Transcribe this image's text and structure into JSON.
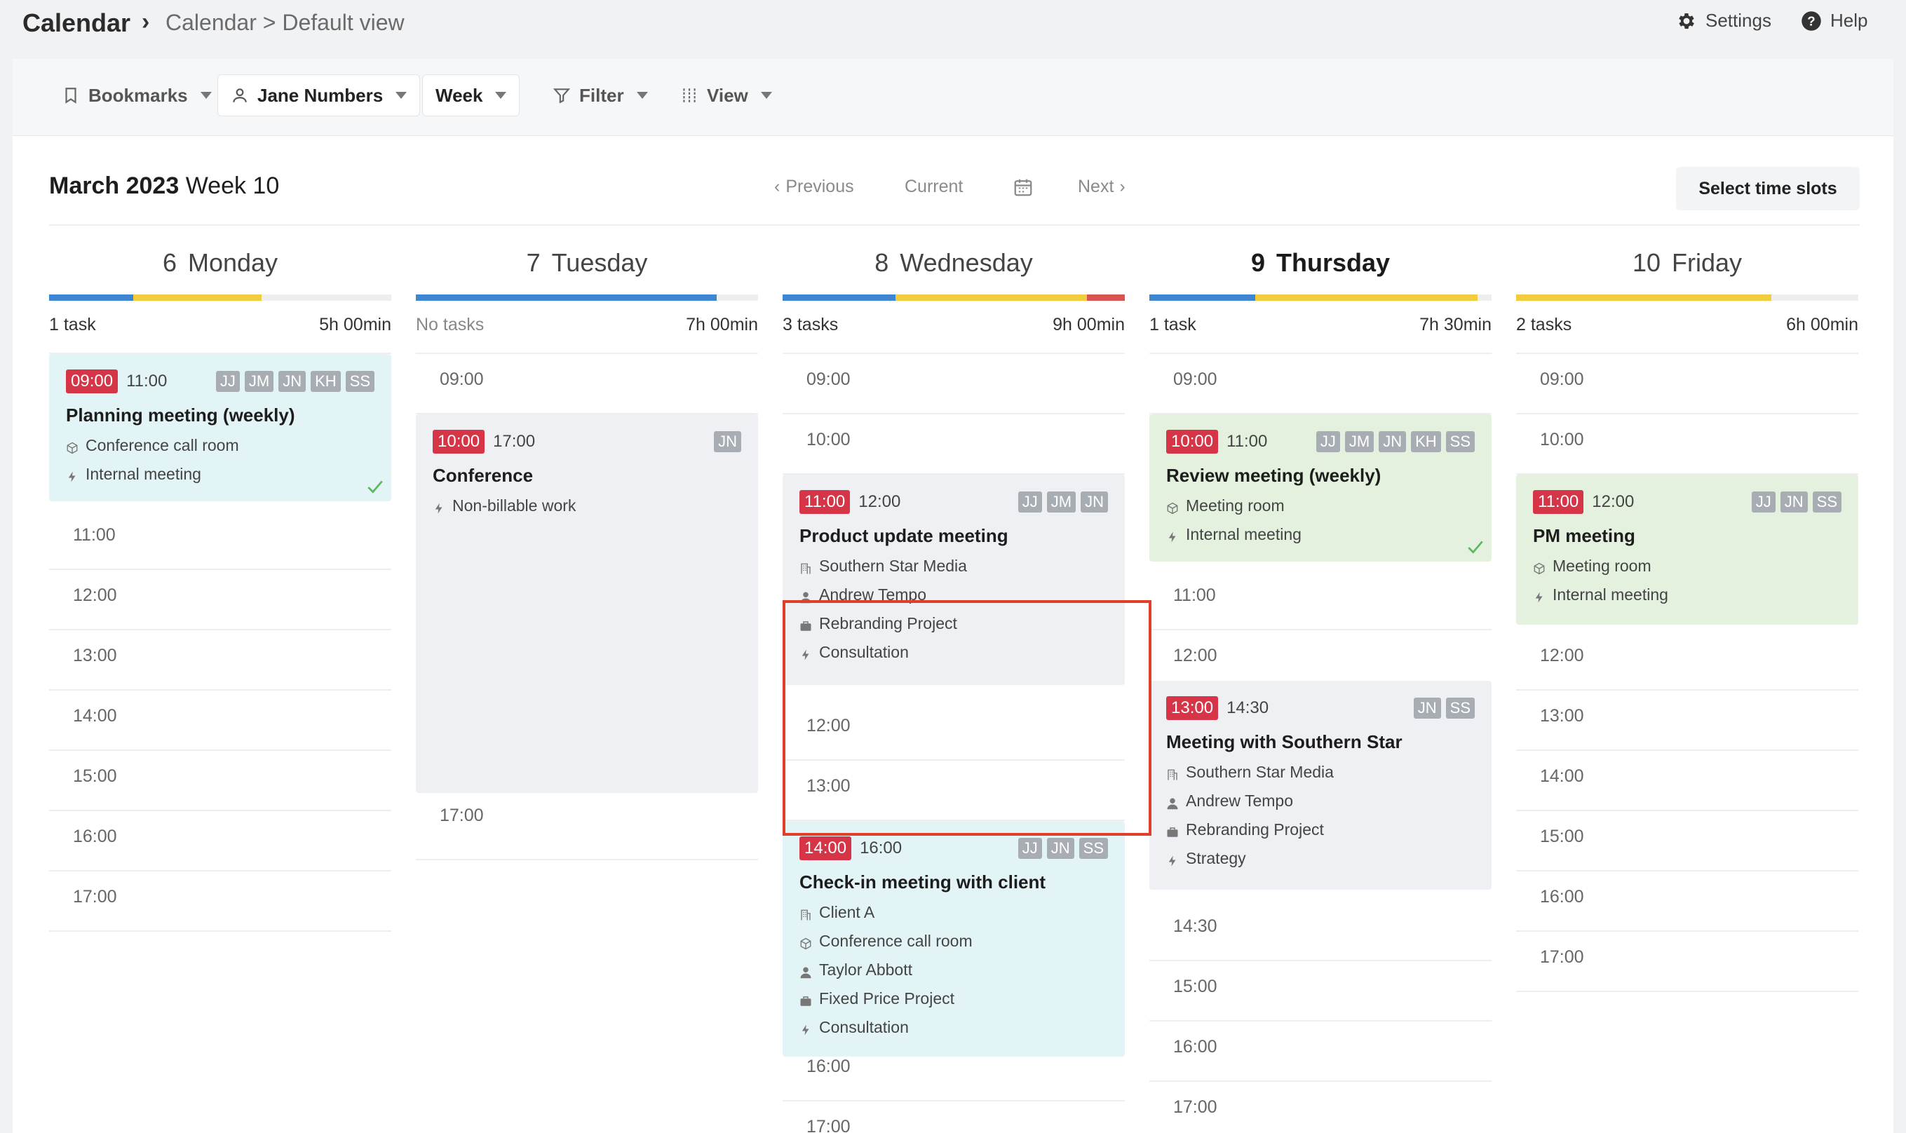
{
  "header": {
    "app_title": "Calendar",
    "breadcrumb_sep": "›",
    "breadcrumb": "Calendar > Default view",
    "settings": "Settings",
    "help": "Help"
  },
  "toolbar": {
    "bookmarks": "Bookmarks",
    "user": "Jane Numbers",
    "range": "Week",
    "filter": "Filter",
    "view": "View"
  },
  "main": {
    "month": "March 2023",
    "week": "Week 10",
    "previous": "Previous",
    "current": "Current",
    "next": "Next",
    "select_slots": "Select time slots"
  },
  "colors": {
    "blue": "#3f86d2",
    "yellow": "#f1cc3f",
    "red": "#d9534f",
    "badge": "#d63547"
  },
  "days": [
    {
      "num": "6",
      "name": "Monday",
      "tasks": "1 task",
      "hours": "5h 00min",
      "bar": [
        {
          "color": "#3f86d2",
          "pct": 24.5
        },
        {
          "color": "#f1cc3f",
          "pct": 37.5
        }
      ],
      "slots": [
        "11:00",
        "12:00",
        "13:00",
        "14:00",
        "15:00",
        "16:00",
        "17:00"
      ],
      "events": [
        {
          "start": "09:00",
          "end": "11:00",
          "initials": [
            "JJ",
            "JM",
            "JN",
            "KH",
            "SS"
          ],
          "title": "Planning meeting (weekly)",
          "lines": [
            {
              "icon": "cube",
              "text": "Conference call room"
            },
            {
              "icon": "bolt",
              "text": "Internal meeting"
            }
          ]
        }
      ]
    },
    {
      "num": "7",
      "name": "Tuesday",
      "tasks": "No tasks",
      "hours": "7h 00min",
      "bar": [
        {
          "color": "#3f86d2",
          "pct": 88
        }
      ],
      "slots": [
        "09:00",
        "17:00"
      ],
      "events": [
        {
          "start": "10:00",
          "end": "17:00",
          "initials": [
            "JN"
          ],
          "title": "Conference",
          "lines": [
            {
              "icon": "bolt",
              "text": "Non-billable work"
            }
          ]
        }
      ]
    },
    {
      "num": "8",
      "name": "Wednesday",
      "tasks": "3 tasks",
      "hours": "9h 00min",
      "bar": [
        {
          "color": "#3f86d2",
          "pct": 33
        },
        {
          "color": "#f1cc3f",
          "pct": 56
        },
        {
          "color": "#d9534f",
          "pct": 11
        }
      ],
      "slots": [
        "09:00",
        "10:00",
        "12:00",
        "13:00",
        "16:00",
        "17:00"
      ],
      "events": [
        {
          "start": "11:00",
          "end": "12:00",
          "initials": [
            "JJ",
            "JM",
            "JN"
          ],
          "title": "Product update meeting",
          "lines": [
            {
              "icon": "building",
              "text": "Southern Star Media"
            },
            {
              "icon": "person",
              "text": "Andrew Tempo"
            },
            {
              "icon": "case",
              "text": "Rebranding Project"
            },
            {
              "icon": "bolt",
              "text": "Consultation"
            }
          ]
        },
        {
          "start": "14:00",
          "end": "16:00",
          "initials": [
            "JJ",
            "JN",
            "SS"
          ],
          "title": "Check-in meeting with client",
          "lines": [
            {
              "icon": "building",
              "text": "Client A"
            },
            {
              "icon": "cube",
              "text": "Conference call room"
            },
            {
              "icon": "person",
              "text": "Taylor Abbott"
            },
            {
              "icon": "case",
              "text": "Fixed Price Project"
            },
            {
              "icon": "bolt",
              "text": "Consultation"
            }
          ]
        }
      ]
    },
    {
      "num": "9",
      "name": "Thursday",
      "tasks": "1 task",
      "hours": "7h 30min",
      "bar": [
        {
          "color": "#3f86d2",
          "pct": 31
        },
        {
          "color": "#f1cc3f",
          "pct": 65
        }
      ],
      "slots": [
        "09:00",
        "11:00",
        "12:00",
        "14:30",
        "15:00",
        "16:00",
        "17:00"
      ],
      "events": [
        {
          "start": "10:00",
          "end": "11:00",
          "initials": [
            "JJ",
            "JM",
            "JN",
            "KH",
            "SS"
          ],
          "title": "Review meeting (weekly)",
          "lines": [
            {
              "icon": "cube",
              "text": "Meeting room"
            },
            {
              "icon": "bolt",
              "text": "Internal meeting"
            }
          ]
        },
        {
          "start": "13:00",
          "end": "14:30",
          "initials": [
            "JN",
            "SS"
          ],
          "title": "Meeting with Southern Star",
          "lines": [
            {
              "icon": "building",
              "text": "Southern Star Media"
            },
            {
              "icon": "person",
              "text": "Andrew Tempo"
            },
            {
              "icon": "case",
              "text": "Rebranding Project"
            },
            {
              "icon": "bolt",
              "text": "Strategy"
            }
          ]
        }
      ]
    },
    {
      "num": "10",
      "name": "Friday",
      "tasks": "2 tasks",
      "hours": "6h 00min",
      "bar": [
        {
          "color": "#f1cc3f",
          "pct": 74.5
        }
      ],
      "slots": [
        "09:00",
        "10:00",
        "12:00",
        "13:00",
        "14:00",
        "15:00",
        "16:00",
        "17:00"
      ],
      "events": [
        {
          "start": "11:00",
          "end": "12:00",
          "initials": [
            "JJ",
            "JN",
            "SS"
          ],
          "title": "PM meeting",
          "lines": [
            {
              "icon": "cube",
              "text": "Meeting room"
            },
            {
              "icon": "bolt",
              "text": "Internal meeting"
            }
          ]
        }
      ]
    }
  ]
}
